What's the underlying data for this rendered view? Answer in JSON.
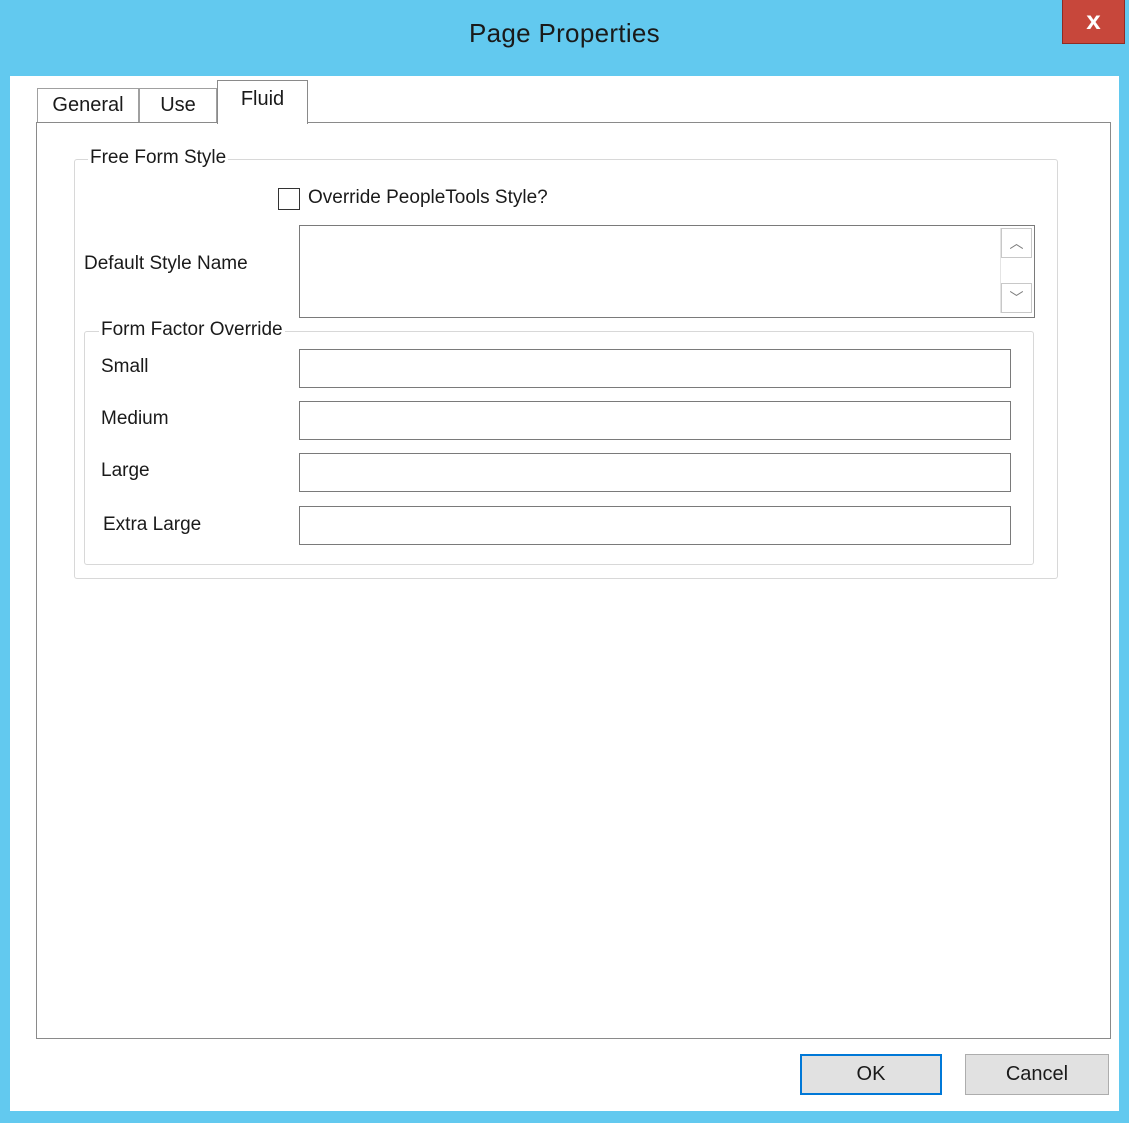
{
  "window": {
    "title": "Page Properties",
    "close_label": "x"
  },
  "tabs": [
    {
      "label": "General",
      "selected": false
    },
    {
      "label": "Use",
      "selected": false
    },
    {
      "label": "Fluid",
      "selected": true
    }
  ],
  "free_form_style": {
    "group_label": "Free Form Style",
    "override_checkbox_label": "Override PeopleTools Style?",
    "override_checked": false,
    "default_style_label": "Default Style Name",
    "default_style_value": ""
  },
  "form_factor_override": {
    "group_label": "Form Factor Override",
    "fields": [
      {
        "label": "Small",
        "value": ""
      },
      {
        "label": "Medium",
        "value": ""
      },
      {
        "label": "Large",
        "value": ""
      },
      {
        "label": "Extra Large",
        "value": ""
      }
    ]
  },
  "buttons": {
    "ok_label": "OK",
    "cancel_label": "Cancel"
  },
  "colors": {
    "frame": "#62c9ef",
    "close_button": "#c7473b"
  }
}
